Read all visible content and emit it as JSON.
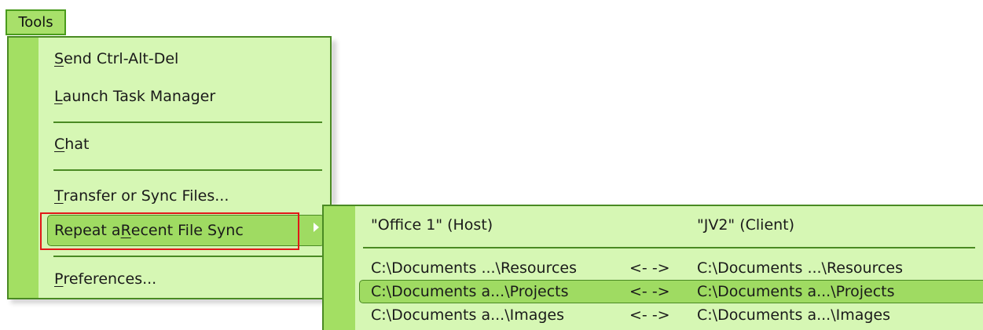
{
  "menubar": {
    "tools_label": "Tools"
  },
  "tools_menu": {
    "items": [
      {
        "pre": "",
        "ul": "S",
        "post": "end Ctrl-Alt-Del"
      },
      {
        "pre": "",
        "ul": "L",
        "post": "aunch Task Manager"
      },
      {
        "pre": "",
        "ul": "C",
        "post": "hat"
      },
      {
        "pre": "",
        "ul": "T",
        "post": "ransfer or Sync Files..."
      },
      {
        "pre": "Repeat a ",
        "ul": "R",
        "post": "ecent File Sync"
      },
      {
        "pre": "",
        "ul": "P",
        "post": "references..."
      }
    ]
  },
  "recent_sync_submenu": {
    "header": {
      "host": "\"Office 1\" (Host)",
      "client": "\"JV2\" (Client)"
    },
    "rows": [
      {
        "host": "C:\\Documents ...\\Resources",
        "arrow": "<- ->",
        "client": "C:\\Documents ...\\Resources"
      },
      {
        "host": "C:\\Documents a...\\Projects",
        "arrow": "<- ->",
        "client": "C:\\Documents a...\\Projects"
      },
      {
        "host": "C:\\Documents a...\\Images",
        "arrow": "<- ->",
        "client": "C:\\Documents a...\\Images"
      }
    ]
  },
  "colors": {
    "menu_bg": "#d6f7b4",
    "menu_strip": "#a3df63",
    "highlight": "#9fdb62",
    "border": "#4a8a23",
    "annotation": "#e01818"
  }
}
